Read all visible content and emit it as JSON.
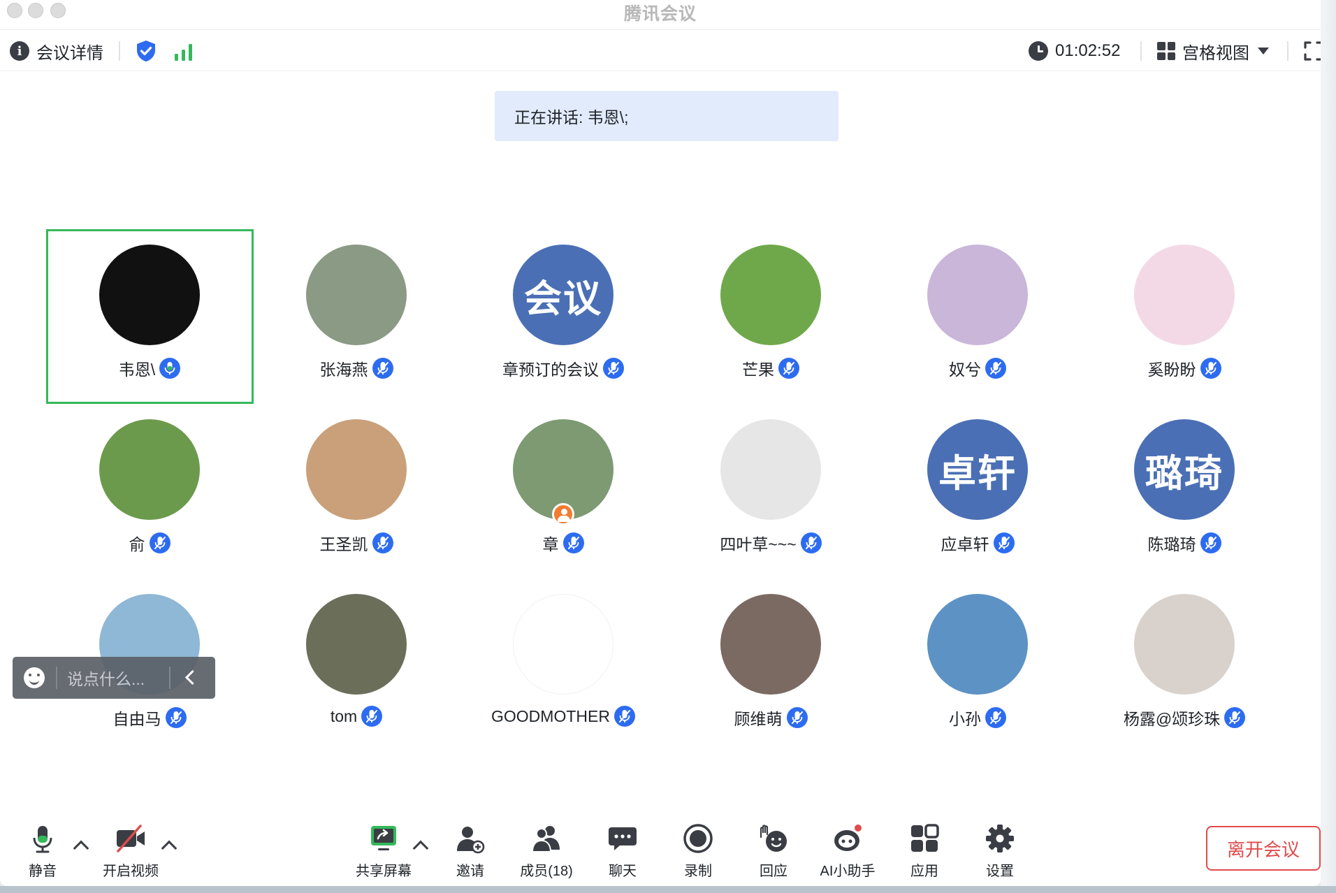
{
  "window": {
    "title": "腾讯会议"
  },
  "topbar": {
    "details_label": "会议详情",
    "timer": "01:02:52",
    "view_label": "宫格视图"
  },
  "speaking_banner": "正在讲话: 韦恩\\;",
  "participants": [
    {
      "name": "韦恩\\",
      "avatar_text": "",
      "avatar_color": "#111111",
      "mic": "active"
    },
    {
      "name": "张海燕",
      "avatar_text": "",
      "avatar_color": "#8a9a84",
      "mic": "muted"
    },
    {
      "name": "章预订的会议",
      "avatar_text": "会议",
      "avatar_color": "#4a6fb5",
      "mic": "muted"
    },
    {
      "name": "芒果",
      "avatar_text": "",
      "avatar_color": "#6fa84a",
      "mic": "muted"
    },
    {
      "name": "奴兮",
      "avatar_text": "",
      "avatar_color": "#c9b6d9",
      "mic": "muted"
    },
    {
      "name": "奚盼盼",
      "avatar_text": "",
      "avatar_color": "#f3d9e6",
      "mic": "muted"
    },
    {
      "name": "俞",
      "avatar_text": "",
      "avatar_color": "#6c9a4c",
      "mic": "muted"
    },
    {
      "name": "王圣凯",
      "avatar_text": "",
      "avatar_color": "#c9a07a",
      "mic": "muted"
    },
    {
      "name": "章",
      "avatar_text": "",
      "avatar_color": "#7d9a72",
      "mic": "muted"
    },
    {
      "name": "四叶草~~~",
      "avatar_text": "",
      "avatar_color": "#e6e6e6",
      "mic": "muted"
    },
    {
      "name": "应卓轩",
      "avatar_text": "卓轩",
      "avatar_color": "#4a6fb5",
      "mic": "muted"
    },
    {
      "name": "陈璐琦",
      "avatar_text": "璐琦",
      "avatar_color": "#4a6fb5",
      "mic": "muted"
    },
    {
      "name": "自由马",
      "avatar_text": "",
      "avatar_color": "#8fb7d6",
      "mic": "muted"
    },
    {
      "name": "tom",
      "avatar_text": "",
      "avatar_color": "#6b6f5a",
      "mic": "muted"
    },
    {
      "name": "GOODMOTHER",
      "avatar_text": "",
      "avatar_color": "#ffffff",
      "mic": "muted"
    },
    {
      "name": "顾维萌",
      "avatar_text": "",
      "avatar_color": "#7a6a62",
      "mic": "muted"
    },
    {
      "name": "小孙",
      "avatar_text": "",
      "avatar_color": "#5d92c4",
      "mic": "muted"
    },
    {
      "name": "杨露@颂珍珠",
      "avatar_text": "",
      "avatar_color": "#d9d2cc",
      "mic": "muted"
    }
  ],
  "chat_popup": {
    "placeholder": "说点什么..."
  },
  "toolbar": {
    "mute": "静音",
    "video": "开启视频",
    "share": "共享屏幕",
    "invite": "邀请",
    "members": "成员(18)",
    "chat": "聊天",
    "record": "录制",
    "react": "回应",
    "ai": "AI小助手",
    "apps": "应用",
    "settings": "设置",
    "leave": "离开会议"
  },
  "colors": {
    "accent_blue": "#2d6cf0",
    "active_speaker_border": "#35b85a",
    "leave_red": "#e04b4b",
    "banner_bg": "#e1ebfb"
  }
}
